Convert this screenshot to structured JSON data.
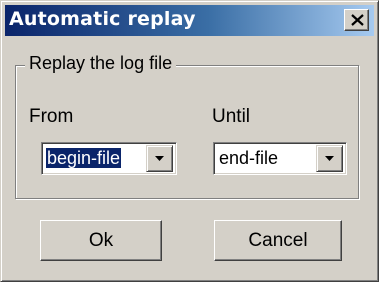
{
  "window": {
    "title": "Automatic replay",
    "close_icon": "close-icon"
  },
  "group": {
    "label": "Replay the log file"
  },
  "from": {
    "label": "From",
    "value": "begin-file",
    "icon": "chevron-down-icon"
  },
  "until": {
    "label": "Until",
    "value": "end-file",
    "icon": "chevron-down-icon"
  },
  "buttons": {
    "ok_label": "Ok",
    "cancel_label": "Cancel"
  },
  "colors": {
    "dialog_face": "#d4d0c8",
    "title_start": "#0a246a",
    "title_end": "#a6caf0",
    "selection": "#0a246a"
  }
}
